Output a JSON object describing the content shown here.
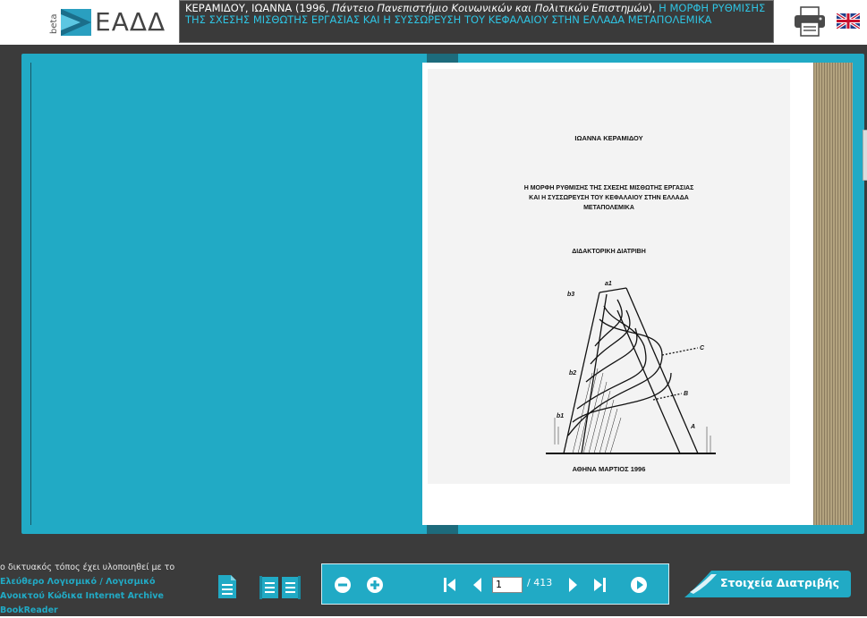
{
  "header": {
    "logo_beta": "beta",
    "logo_text": "ΕΑΔΔ",
    "title_author": "ΚΕΡΑΜΙΔΟΥ, ΙΩΑΝΝΑ (1996,",
    "title_institution": "Πάντειο Πανεπιστήμιο Κοινωνικών και Πολιτικών Επιστημών",
    "title_close": "),",
    "title_link": "Η ΜΟΡΦΗ ΡΥΘΜΙΣΗΣ ΤΗΣ ΣΧΕΣΗΣ ΜΙΣΘΩΤΗΣ ΕΡΓΑΣΙΑΣ ΚΑΙ Η ΣΥΣΣΩΡΕΥΣΗ ΤΟΥ ΚΕΦΑΛΑΙΟΥ ΣΤΗΝ ΕΛΛΑΔΑ ΜΕΤΑΠΟΛΕΜΙΚΑ"
  },
  "scan": {
    "author": "ΙΩΑΝΝΑ ΚΕΡΑΜΙΔΟΥ",
    "title_line1": "Η ΜΟΡΦΗ ΡΥΘΜΙΣΗΣ ΤΗΣ ΣΧΕΣΗΣ ΜΙΣΘΩΤΗΣ ΕΡΓΑΣΙΑΣ",
    "title_line2": "ΚΑΙ Η ΣΥΣΣΩΡΕΥΣΗ ΤΟΥ ΚΕΦΑΛΑΙΟΥ ΣΤΗΝ ΕΛΛΑΔΑ",
    "title_line3": "ΜΕΤΑΠΟΛΕΜΙΚΑ",
    "doc_type": "ΔΙΔΑΚΤΟΡΙΚΗ ΔΙΑΤΡΙΒΗ",
    "place_date": "ΑΘΗΝΑ ΜΑΡΤΙΟΣ 1996",
    "figure_labels": [
      "a1",
      "b3",
      "C",
      "b2",
      "B",
      "b1",
      "A"
    ]
  },
  "footer": {
    "credit_prefix": "ο δικτυακός τόπος έχει υλοποιηθεί με το",
    "credit_link1": "Ελεύθερο Λογισμικό / Λογισμικό",
    "credit_link2": "Ανοικτού Κώδικα Internet Archive",
    "credit_link3": "BookReader",
    "current_page": "1",
    "total_pages": "/ 413",
    "details_label": "Στοιχεία Διατριβής"
  },
  "colors": {
    "accent": "#21aac5",
    "dark_bg": "#3b3b3b",
    "link": "#2fc4e3"
  }
}
